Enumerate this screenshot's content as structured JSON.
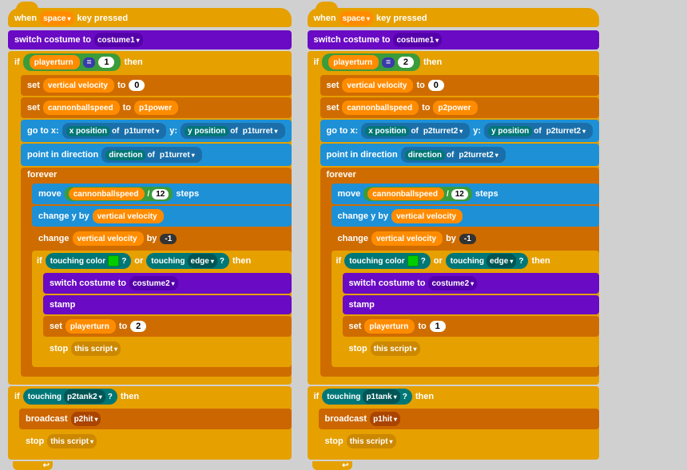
{
  "left_script": {
    "hat": "when space ▾ key pressed",
    "blocks": [
      {
        "type": "switch-costume",
        "label": "switch costume to",
        "value": "costume1"
      },
      {
        "type": "if",
        "condition": "playerturn = 1",
        "then_blocks": [
          {
            "type": "set-var",
            "label": "set",
            "var": "vertical velocity",
            "to": "0"
          },
          {
            "type": "set-var",
            "label": "set",
            "var": "cannonballspeed",
            "to": "p1power"
          },
          {
            "type": "goto",
            "label": "go to x:",
            "xof": "x position",
            "xvar": "p1turret",
            "ylabel": "y:",
            "yof": "y position",
            "yvar": "p1turret"
          },
          {
            "type": "point",
            "label": "point in direction",
            "dir": "direction",
            "dirvar": "p1turret"
          },
          {
            "type": "forever",
            "body_blocks": [
              {
                "type": "move",
                "label": "move",
                "var": "cannonballspeed",
                "op": "/",
                "val": "12",
                "steps": "steps"
              },
              {
                "type": "change-y",
                "label": "change y by",
                "var": "vertical velocity"
              },
              {
                "type": "change-var",
                "label": "change",
                "var": "vertical velocity",
                "by": "-1"
              },
              {
                "type": "if",
                "condition": "touching color ? or touching edge ? then",
                "then_blocks": [
                  {
                    "type": "switch-costume",
                    "label": "switch costume to",
                    "value": "costume2"
                  },
                  {
                    "type": "stamp",
                    "label": "stamp"
                  },
                  {
                    "type": "set-var",
                    "label": "set",
                    "var": "playerturn",
                    "to": "2"
                  },
                  {
                    "type": "stop",
                    "label": "stop",
                    "value": "this script"
                  }
                ]
              }
            ]
          }
        ]
      },
      {
        "type": "if-touching",
        "label": "if touching p2tank2 ? then",
        "body_blocks": [
          {
            "type": "broadcast",
            "label": "broadcast",
            "value": "p2hit"
          },
          {
            "type": "stop",
            "label": "stop",
            "value": "this script"
          }
        ]
      }
    ]
  },
  "right_script": {
    "hat": "when space ▾ key pressed",
    "blocks": [
      {
        "type": "switch-costume",
        "label": "switch costume to",
        "value": "costume1"
      },
      {
        "type": "if",
        "condition": "playerturn = 2",
        "then_blocks": [
          {
            "type": "set-var",
            "label": "set",
            "var": "vertical velocity",
            "to": "0"
          },
          {
            "type": "set-var",
            "label": "set",
            "var": "cannonballspeed",
            "to": "p2power"
          },
          {
            "type": "goto",
            "label": "go to x:",
            "xof": "x position",
            "xvar": "p2turret2",
            "ylabel": "y:",
            "yof": "y position",
            "yvar": "p2turret2"
          },
          {
            "type": "point",
            "label": "point in direction",
            "dir": "direction",
            "dirvar": "p2turret2"
          },
          {
            "type": "forever",
            "body_blocks": [
              {
                "type": "move",
                "label": "move",
                "var": "cannonballspeed",
                "op": "/",
                "val": "12",
                "steps": "steps"
              },
              {
                "type": "change-y",
                "label": "change y by",
                "var": "vertical velocity"
              },
              {
                "type": "change-var",
                "label": "change",
                "var": "vertical velocity",
                "by": "-1"
              },
              {
                "type": "if",
                "condition": "touching color ? or touching edge ? then",
                "then_blocks": [
                  {
                    "type": "switch-costume",
                    "label": "switch costume to",
                    "value": "costume2"
                  },
                  {
                    "type": "stamp",
                    "label": "stamp"
                  },
                  {
                    "type": "set-var",
                    "label": "set",
                    "var": "playerturn",
                    "to": "1"
                  },
                  {
                    "type": "stop",
                    "label": "stop",
                    "value": "this script"
                  }
                ]
              }
            ]
          }
        ]
      },
      {
        "type": "if-touching",
        "label": "if touching p1tank ? then",
        "body_blocks": [
          {
            "type": "broadcast",
            "label": "broadcast",
            "value": "p1hit"
          },
          {
            "type": "stop",
            "label": "stop",
            "value": "this script"
          }
        ]
      }
    ]
  },
  "colors": {
    "hat": "#e6a000",
    "motion": "#1e90d6",
    "looks": "#9932cc",
    "control": "#e6a000",
    "sensing": "#007777",
    "operators": "#3a9c3a",
    "variables": "#ff8c00",
    "sound": "#cc6600"
  }
}
